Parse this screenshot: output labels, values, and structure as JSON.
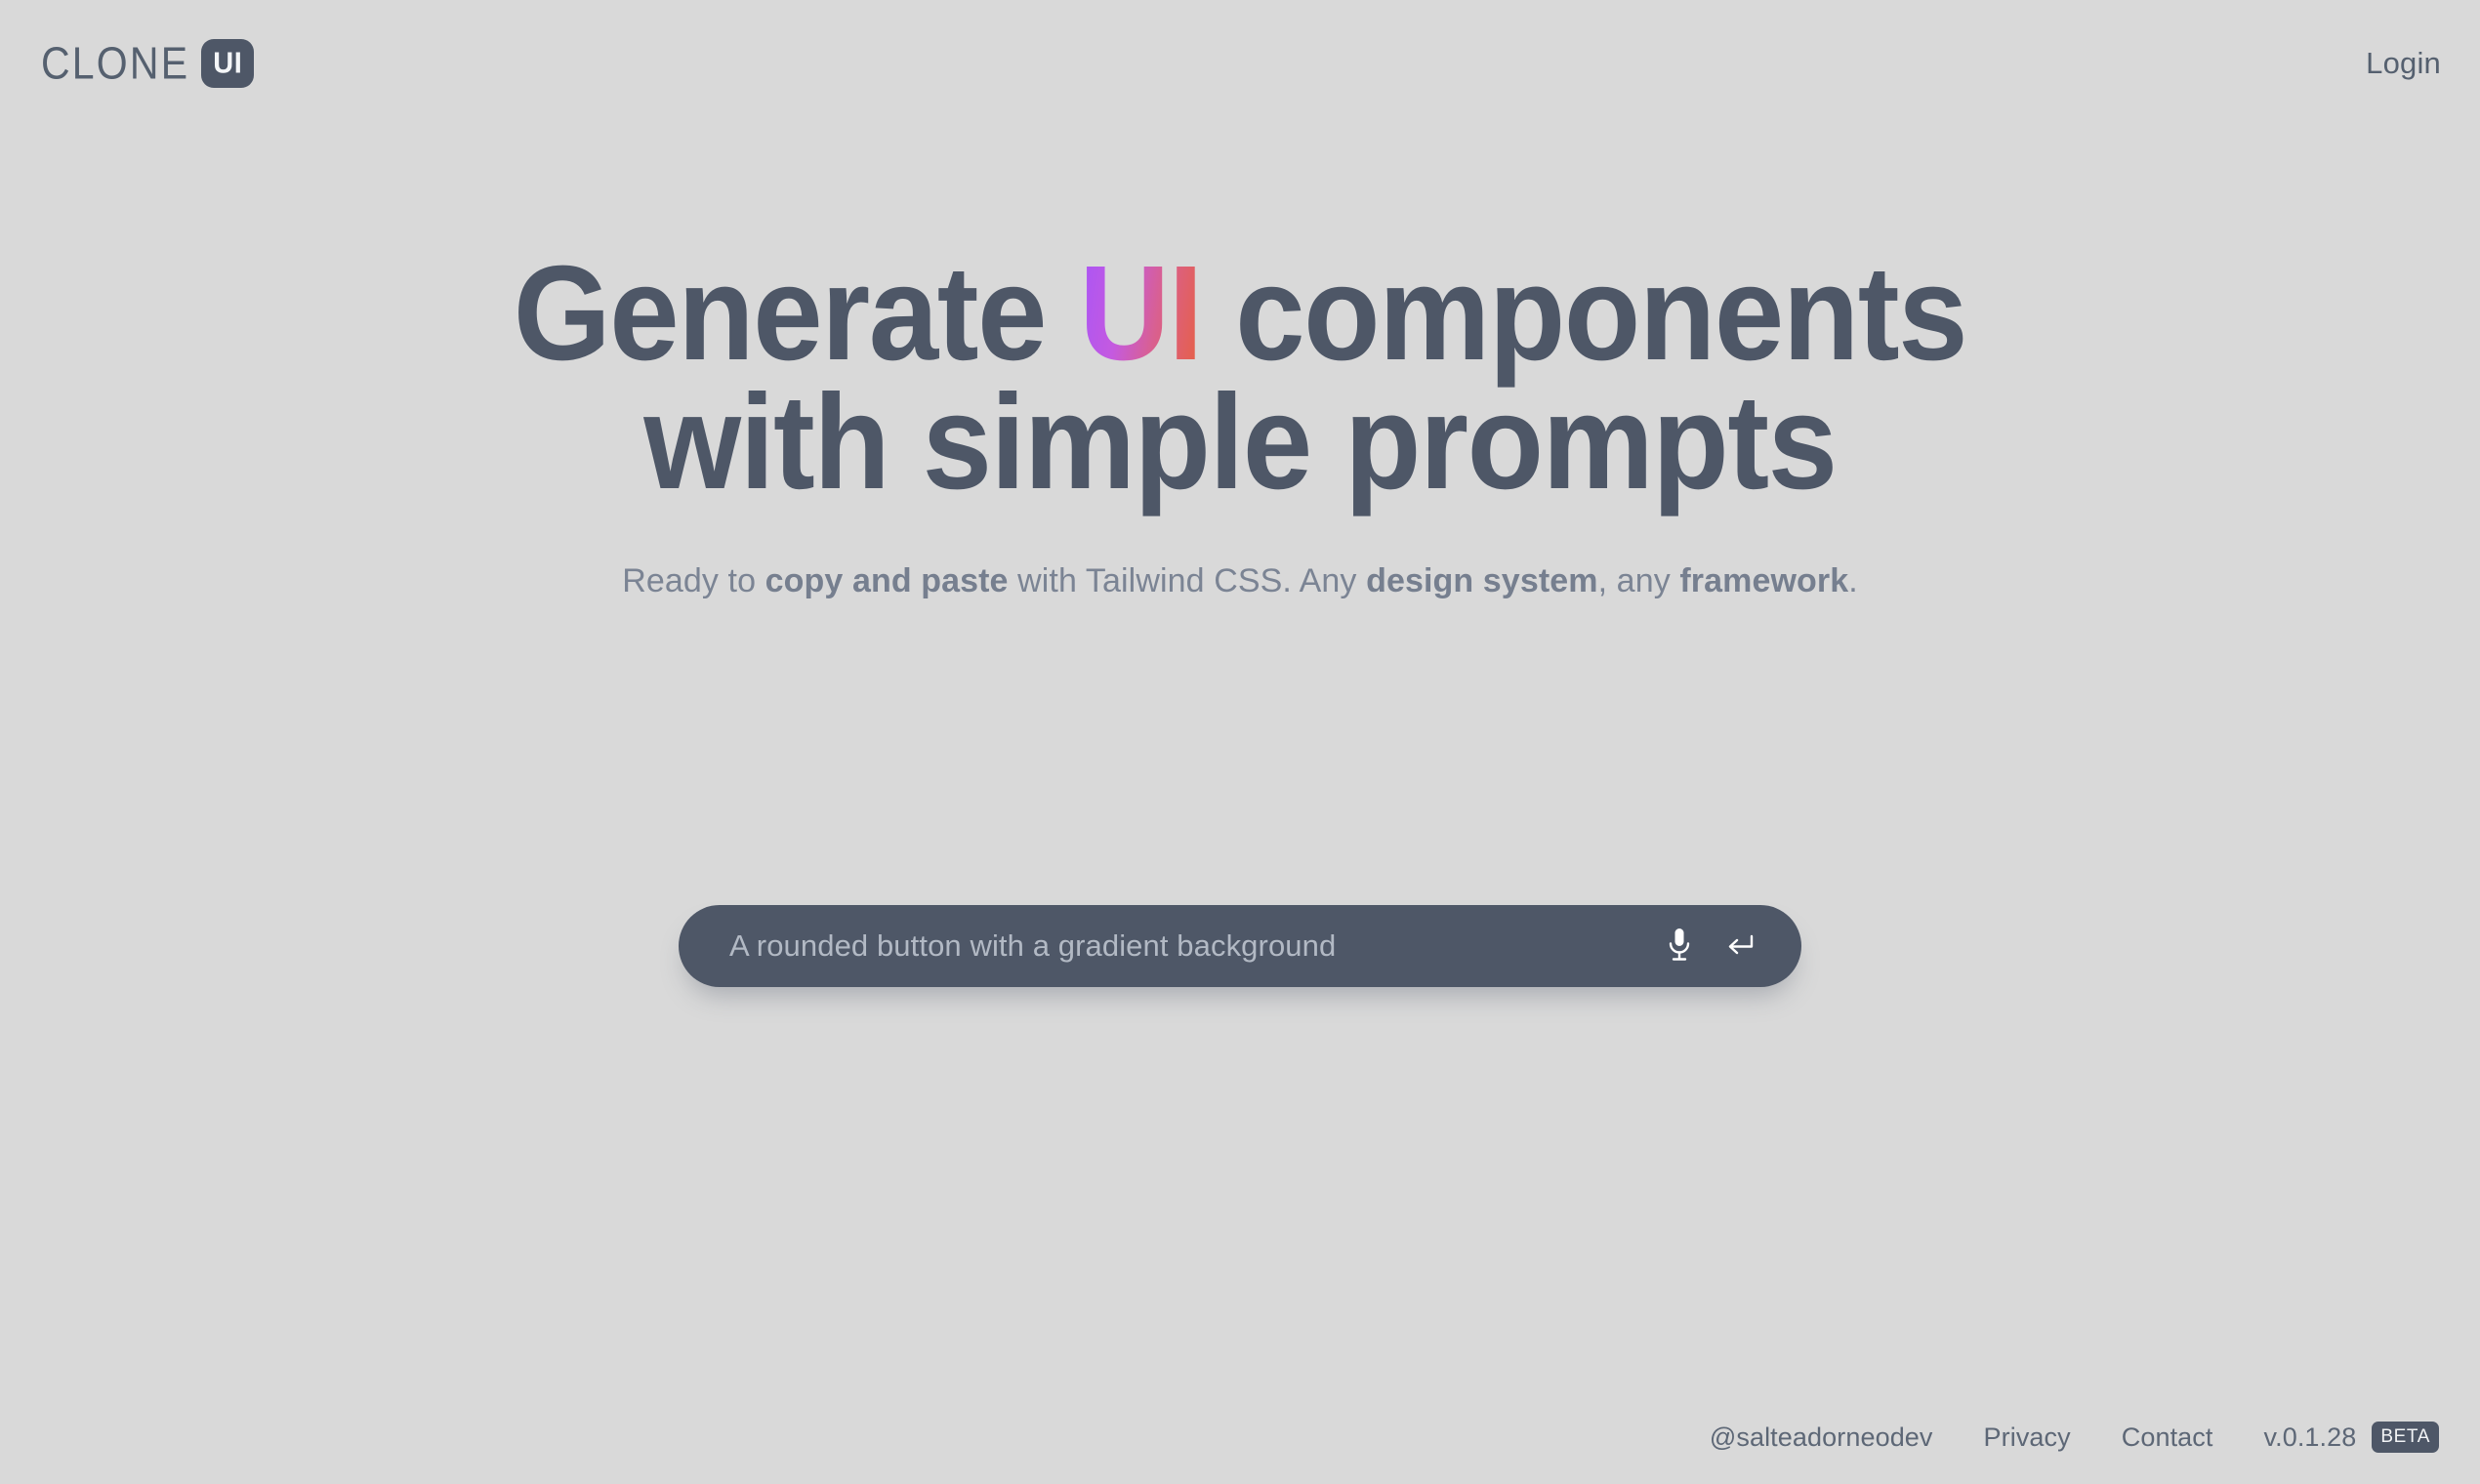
{
  "header": {
    "logo": {
      "word": "CLONE",
      "badge": "UI"
    },
    "login_label": "Login"
  },
  "hero": {
    "headline_line1_before": "Generate ",
    "headline_accent": "UI",
    "headline_line1_after": " components",
    "headline_line2": "with simple prompts",
    "subtitle": {
      "part1": "Ready to ",
      "bold1": "copy and paste",
      "part2": " with Tailwind CSS. Any ",
      "bold2": "design system",
      "part3": ", any ",
      "bold3": "framework",
      "part4": "."
    }
  },
  "prompt": {
    "value": "",
    "placeholder": "A rounded button with a gradient background",
    "mic_icon": "microphone-icon",
    "submit_icon": "enter-return-icon"
  },
  "footer": {
    "handle": "@salteadorneodev",
    "privacy": "Privacy",
    "contact": "Contact",
    "version": "v.0.1.28",
    "beta": "BETA"
  },
  "colors": {
    "background": "#d9d9d9",
    "slate": "#4e5767",
    "muted_text": "#7b8494",
    "gradient_start": "#a855f7",
    "gradient_mid": "#d9608f",
    "gradient_end": "#e8603c",
    "placeholder": "#b2b9c4"
  }
}
